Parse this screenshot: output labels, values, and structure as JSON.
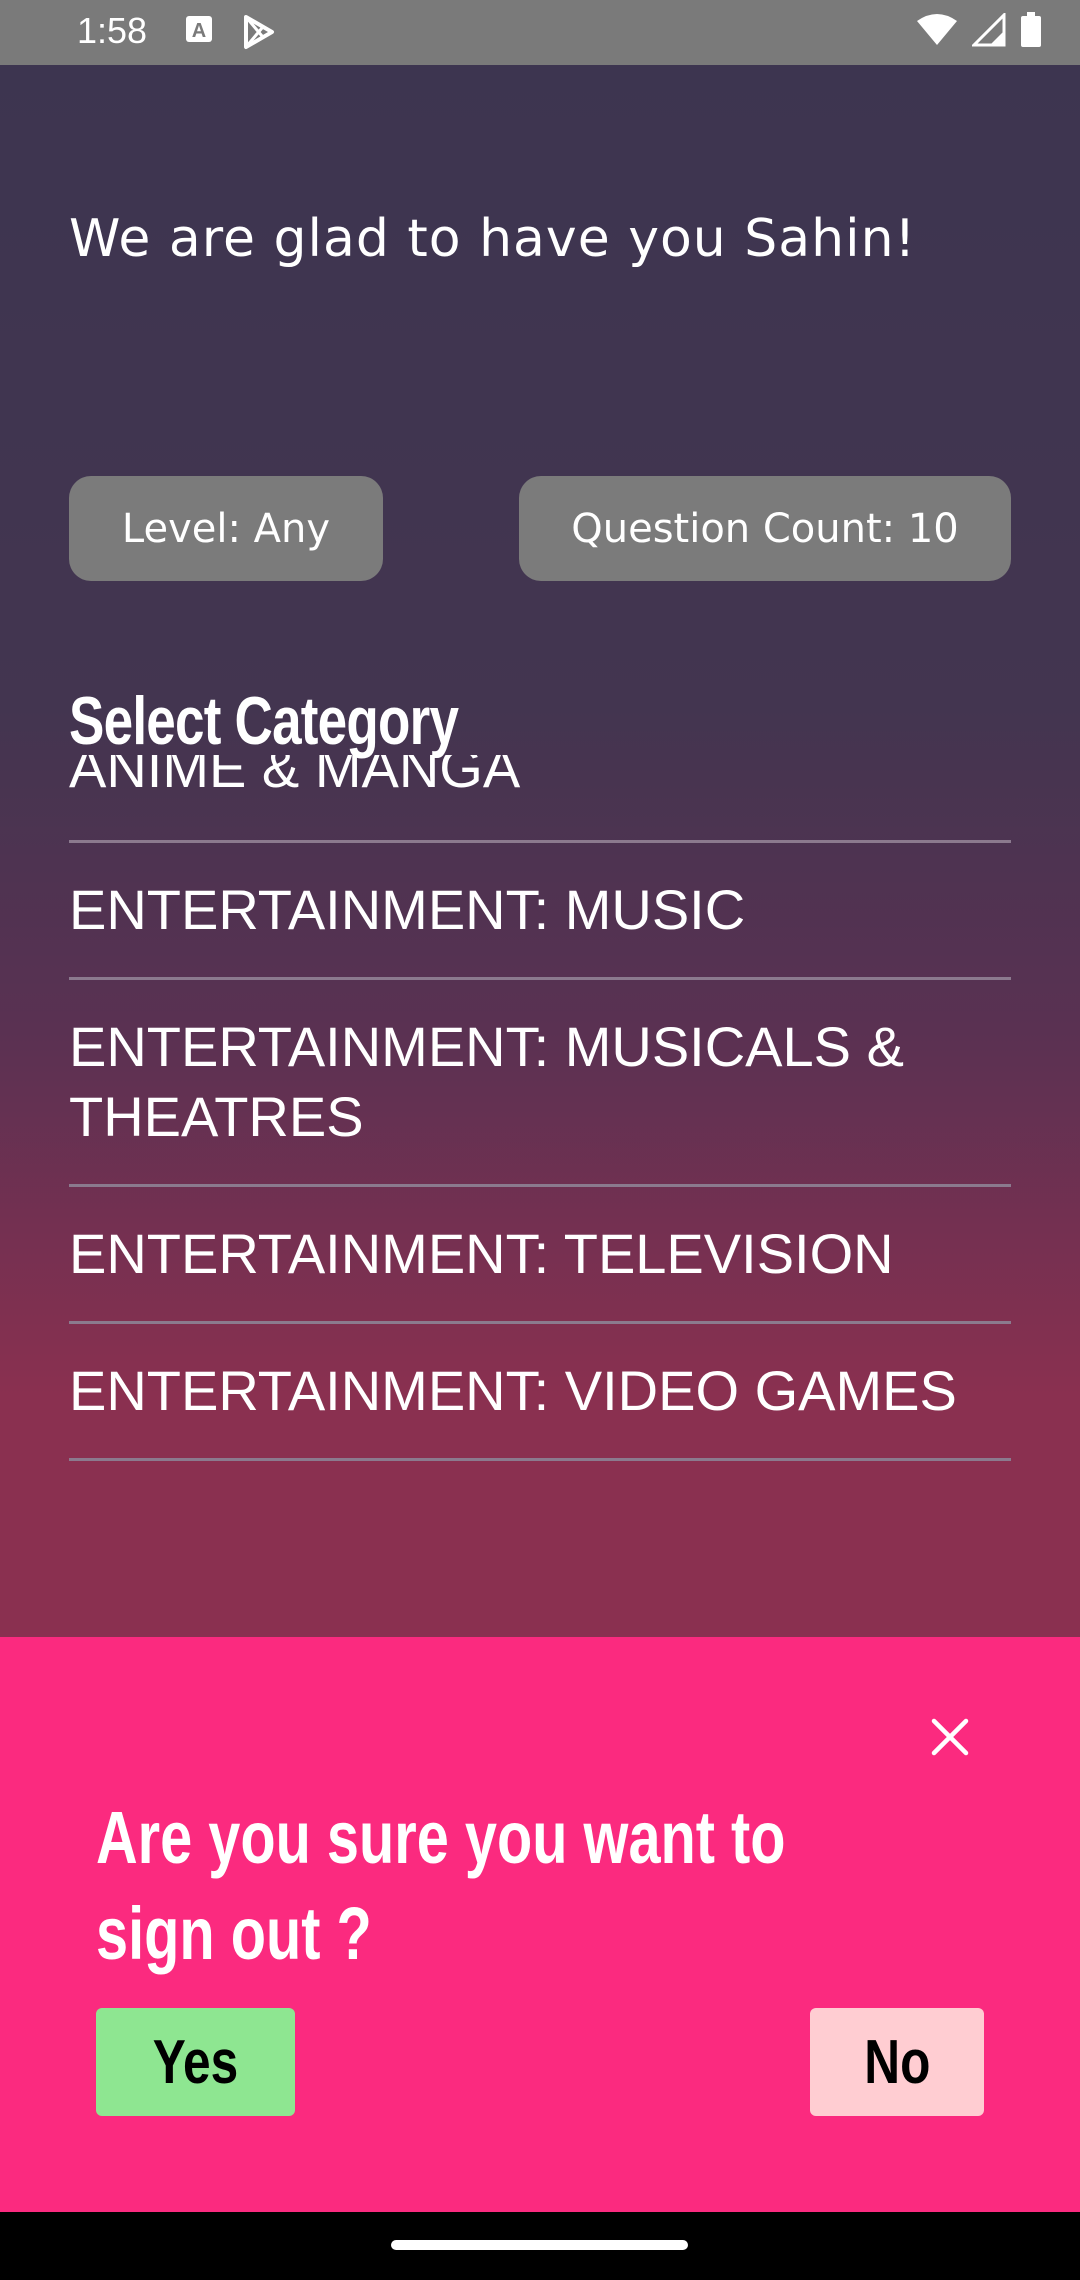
{
  "status_bar": {
    "time": "1:58",
    "left_icons": [
      "a-letter-icon",
      "play-store-icon"
    ],
    "right_icons": [
      "wifi-icon",
      "cell-signal-icon",
      "battery-icon"
    ]
  },
  "welcome_text": "We are glad to have you Sahin!",
  "chips": {
    "level": "Level: Any",
    "question_count": "Question Count: 10"
  },
  "select_category_title": "Select Category",
  "categories": [
    "ANIME & MANGA",
    "ENTERTAINMENT: MUSIC",
    "ENTERTAINMENT: MUSICALS & THEATRES",
    "ENTERTAINMENT: TELEVISION",
    "ENTERTAINMENT: VIDEO GAMES"
  ],
  "sign_out_sheet": {
    "question": "Are you sure you want to sign out ?",
    "yes_label": "Yes",
    "no_label": "No",
    "close_icon": "close-icon"
  },
  "colors": {
    "sheet_bg": "#fb2a7f",
    "yes_bg": "#8ee691",
    "no_bg": "#ffcdd2",
    "chip_bg": "#7b7b7b"
  }
}
